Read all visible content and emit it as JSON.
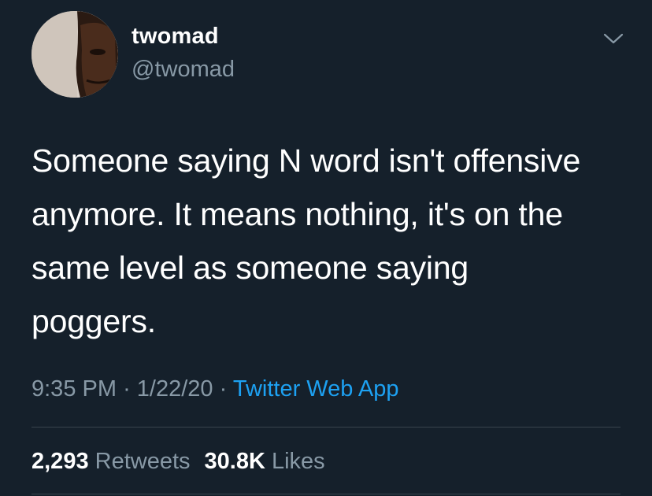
{
  "tweet": {
    "display_name": "twomad",
    "handle": "@twomad",
    "text": "Someone saying N word isn't offensive\nanymore. It means nothing, it's on the\nsame level as someone saying\npoggers.",
    "time": "9:35 PM",
    "separator": "·",
    "date": "1/22/20",
    "source": "Twitter Web App"
  },
  "stats": {
    "retweets_count": "2,293",
    "retweets_label": "Retweets",
    "likes_count": "30.8K",
    "likes_label": "Likes"
  },
  "icons": {
    "avatar": "profile-photo",
    "menu": "chevron-down-icon"
  },
  "colors": {
    "background": "#15202b",
    "secondary_text": "#8899a6",
    "link": "#1da1f2",
    "divider": "#38444d"
  }
}
